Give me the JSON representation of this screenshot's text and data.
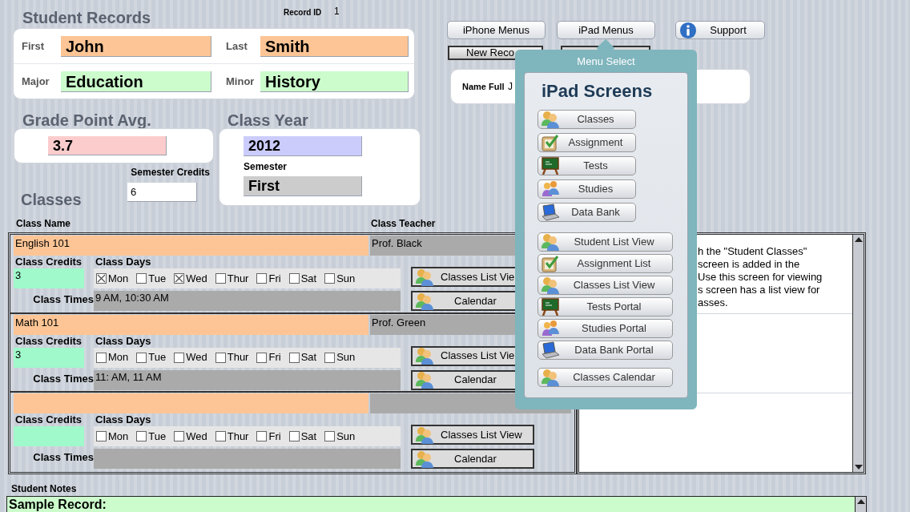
{
  "title": "Student Records",
  "record_id": {
    "label": "Record ID",
    "value": "1"
  },
  "name_rows": [
    [
      {
        "label": "First",
        "value": "John"
      },
      {
        "label": "Last",
        "value": "Smith"
      }
    ],
    [
      {
        "label": "Major",
        "value": "Education"
      },
      {
        "label": "Minor",
        "value": "History"
      }
    ]
  ],
  "gpa": {
    "title": "Grade Point Avg.",
    "value": "3.7"
  },
  "class_year": {
    "title": "Class Year",
    "year": "2012",
    "semester_label": "Semester",
    "semester": "First"
  },
  "semester_credits": {
    "label": "Semester Credits",
    "value": "6"
  },
  "classes_title": "Classes",
  "top_buttons": [
    {
      "label": "iPhone Menus",
      "kind": "plain"
    },
    {
      "label": "iPad Menus",
      "kind": "plain"
    },
    {
      "label": "Support",
      "kind": "info"
    }
  ],
  "record_button": "New Reco",
  "name_full": {
    "label": "Name Full",
    "value": "J"
  },
  "portal": {
    "columns": [
      "Class Name",
      "Class Teacher"
    ],
    "rows": [
      {
        "name": "English 101",
        "teacher": "Prof. Black",
        "credits_label": "Class Credits",
        "credits": "3",
        "days_label": "Class Days",
        "days": [
          {
            "label": "Mon",
            "checked": true
          },
          {
            "label": "Tue",
            "checked": false
          },
          {
            "label": "Wed",
            "checked": true
          },
          {
            "label": "Thur",
            "checked": false
          },
          {
            "label": "Fri",
            "checked": false
          },
          {
            "label": "Sat",
            "checked": false
          },
          {
            "label": "Sun",
            "checked": false
          }
        ],
        "times_label": "Class Times",
        "times": "9 AM, 10:30 AM",
        "buttons": [
          "Classes List Vie",
          "Calendar"
        ]
      },
      {
        "name": "Math 101",
        "teacher": "Prof. Green",
        "credits_label": "Class Credits",
        "credits": "3",
        "days_label": "Class Days",
        "days": [
          {
            "label": "Mon",
            "checked": false
          },
          {
            "label": "Tue",
            "checked": false
          },
          {
            "label": "Wed",
            "checked": false
          },
          {
            "label": "Thur",
            "checked": false
          },
          {
            "label": "Fri",
            "checked": false
          },
          {
            "label": "Sat",
            "checked": false
          },
          {
            "label": "Sun",
            "checked": false
          }
        ],
        "times_label": "Class Times",
        "times": "11: AM, 11 AM",
        "buttons": [
          "Classes List Vie",
          "Calendar"
        ]
      },
      {
        "credits_label": "Class Credits",
        "days_label": "Class Days",
        "days": [
          {
            "label": "Mon",
            "checked": false
          },
          {
            "label": "Tue",
            "checked": false
          },
          {
            "label": "Wed",
            "checked": false
          },
          {
            "label": "Thur",
            "checked": false
          },
          {
            "label": "Fri",
            "checked": false
          },
          {
            "label": "Sat",
            "checked": false
          },
          {
            "label": "Sun",
            "checked": false
          }
        ],
        "times_label": "Class Times",
        "buttons": [
          "Classes List View",
          "Calendar"
        ]
      }
    ]
  },
  "info_text": "h the \"Student Classes\"\nscreen is added in the\nUse this screen for viewing\ns screen has a list view for\nasses.",
  "student_notes": {
    "label": "Student Notes",
    "value": "Sample Record:"
  },
  "popover": {
    "title": "Menu Select",
    "heading": "iPad Screens",
    "groups": [
      [
        {
          "label": "Classes",
          "kind": "people"
        },
        {
          "label": "Assignment",
          "kind": "assignment"
        },
        {
          "label": "Tests",
          "kind": "board"
        },
        {
          "label": "Studies",
          "kind": "studies"
        },
        {
          "label": "Data Bank",
          "kind": "laptop"
        }
      ],
      [
        {
          "label": "Student List View",
          "kind": "people"
        },
        {
          "label": "Assignment List",
          "kind": "assignment"
        },
        {
          "label": "Classes List View",
          "kind": "people"
        },
        {
          "label": "Tests Portal",
          "kind": "board"
        },
        {
          "label": "Studies Portal",
          "kind": "studies"
        },
        {
          "label": "Data Bank Portal",
          "kind": "laptop"
        }
      ],
      [
        {
          "label": "Classes Calendar",
          "kind": "people"
        }
      ]
    ]
  }
}
